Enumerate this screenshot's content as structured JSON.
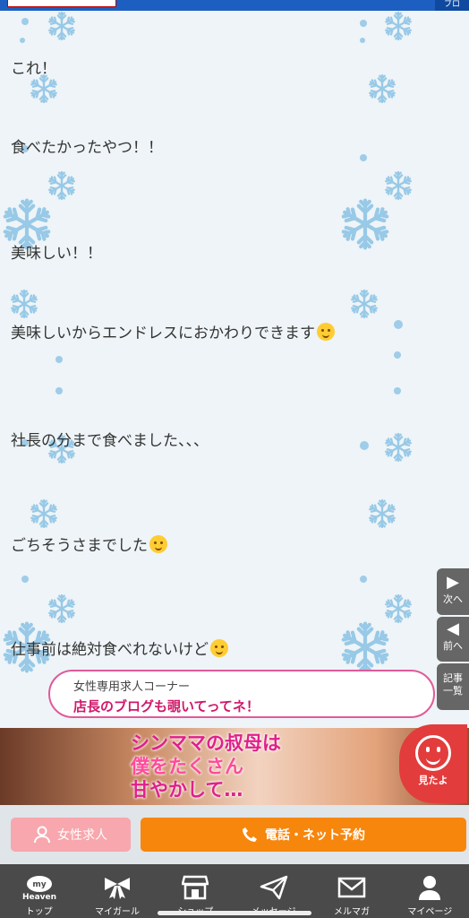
{
  "header": {
    "corner_label": "ブロ"
  },
  "post": {
    "lines": [
      "これ！",
      "食べたかったやつ！！",
      "美味しい！！",
      "美味しいからエンドレスにおかわりできます",
      "社長の分まで食べました、、、",
      "ごちそうさまでした",
      "仕事前は絶対食べれないけど"
    ]
  },
  "side_nav": {
    "next": "次へ",
    "prev": "前へ",
    "list": "記事一覧"
  },
  "recruit_banner": {
    "small": "女性専用求人コーナー",
    "big": "店長のブログも覗いてってネ！"
  },
  "ad": {
    "line1": "シンママの叔母は",
    "line2": "僕をたくさん",
    "line3": "甘やかして…"
  },
  "mita": {
    "label": "見たよ"
  },
  "cta": {
    "recruit": "女性求人",
    "reserve": "電話・ネット予約"
  },
  "tabs": [
    {
      "label": "トップ",
      "icon": "my-heaven-icon",
      "sub": "Heaven",
      "top": "my"
    },
    {
      "label": "マイガール",
      "icon": "ribbon-icon"
    },
    {
      "label": "ショップ",
      "icon": "shop-icon"
    },
    {
      "label": "メッセージ",
      "icon": "paper-plane-icon"
    },
    {
      "label": "メルマガ",
      "icon": "mail-icon"
    },
    {
      "label": "マイページ",
      "icon": "user-icon"
    }
  ],
  "colors": {
    "accent_pink": "#d0186a",
    "call_orange": "#f7860d",
    "tab_bg": "#4a4a4a"
  }
}
